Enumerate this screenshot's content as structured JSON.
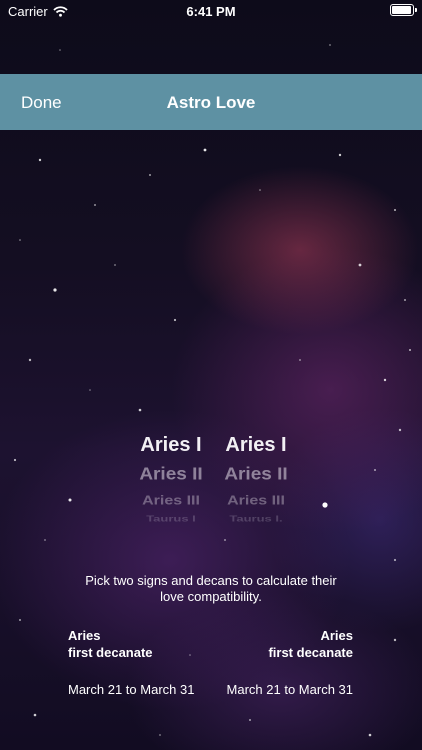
{
  "status_bar": {
    "carrier": "Carrier",
    "time": "6:41 PM",
    "battery_level": 1.0
  },
  "nav_bar": {
    "done_label": "Done",
    "title": "Astro Love",
    "background_color": "#5e91a3"
  },
  "picker": {
    "left": [
      "Aries I",
      "Aries II",
      "Aries III",
      "Taurus I"
    ],
    "right": [
      "Aries I",
      "Aries II",
      "Aries III",
      "Taurus I."
    ]
  },
  "instructions": {
    "line1": "Pick two signs and decans to calculate their",
    "line2": "love compatibility."
  },
  "left_result": {
    "sign": "Aries",
    "decanate": "first decanate",
    "dates": "March 21 to March 31"
  },
  "right_result": {
    "sign": "Aries",
    "decanate": "first decanate",
    "dates": "March 21 to March 31"
  }
}
